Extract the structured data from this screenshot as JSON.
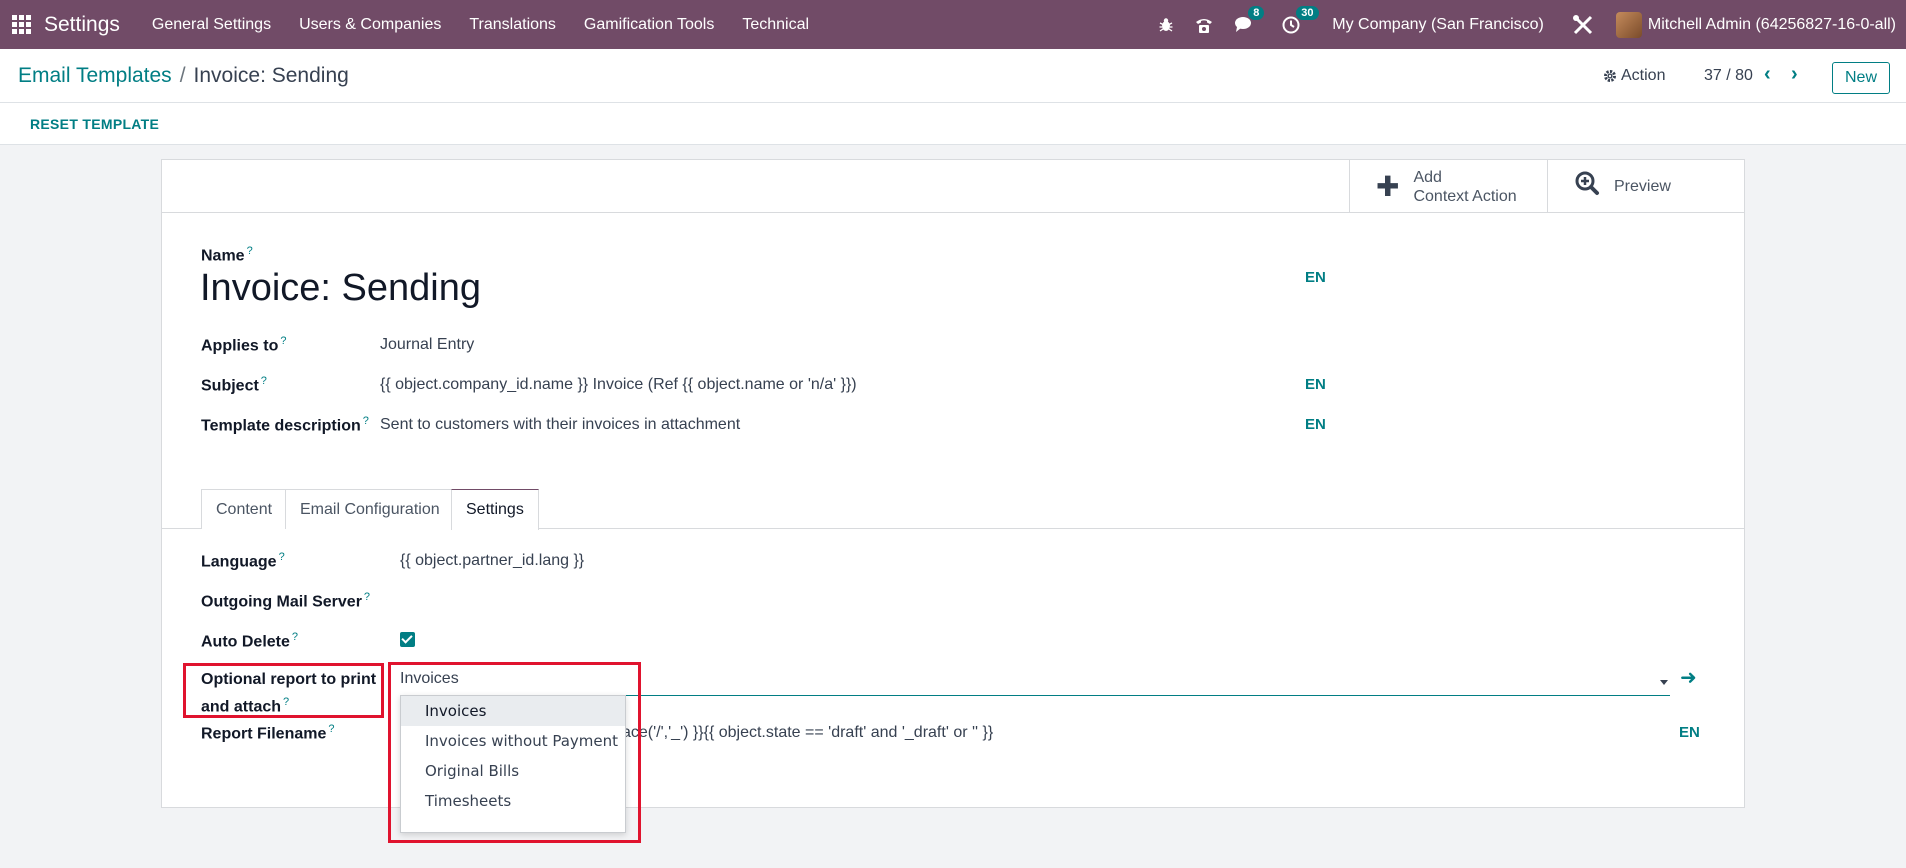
{
  "navbar": {
    "app_name": "Settings",
    "menu": [
      "General Settings",
      "Users & Companies",
      "Translations",
      "Gamification Tools",
      "Technical"
    ],
    "chat_badge": "8",
    "activity_badge": "30",
    "company": "My Company (San Francisco)",
    "user": "Mitchell Admin (64256827-16-0-all)",
    "color": "#714b67"
  },
  "control": {
    "breadcrumb_parent": "Email Templates",
    "breadcrumb_sep": "/",
    "breadcrumb_current": "Invoice: Sending",
    "action_label": "Action",
    "pager": "37 / 80",
    "new_label": "New"
  },
  "statusbar": {
    "reset_label": "RESET TEMPLATE"
  },
  "smart_buttons": {
    "add_line1": "Add",
    "add_line2": "Context Action",
    "preview": "Preview"
  },
  "form": {
    "name_label": "Name",
    "name_value": "Invoice: Sending",
    "applies_label": "Applies to",
    "applies_value": "Journal Entry",
    "subject_label": "Subject",
    "subject_value": "{{ object.company_id.name }} Invoice (Ref {{ object.name or 'n/a' }})",
    "desc_label": "Template description",
    "desc_value": "Sent to customers with their invoices in attachment",
    "lang_tag": "EN",
    "help_mark": "?"
  },
  "tabs": [
    "Content",
    "Email Configuration",
    "Settings"
  ],
  "settings": {
    "language_label": "Language",
    "language_value": "{{ object.partner_id.lang }}",
    "mail_server_label": "Outgoing Mail Server",
    "auto_delete_label": "Auto Delete",
    "report_label_line1": "Optional report to print",
    "report_label_line2": "and attach",
    "report_value": "Invoices",
    "filename_label": "Report Filename",
    "filename_value": "ace('/','_') }}{{ object.state == 'draft' and '_draft' or '' }}",
    "filename_lang": "EN"
  },
  "dropdown": {
    "options": [
      "Invoices",
      "Invoices without Payment",
      "Original Bills",
      "Timesheets"
    ]
  },
  "colors": {
    "accent": "#017e84",
    "highlight": "#e0132e"
  }
}
